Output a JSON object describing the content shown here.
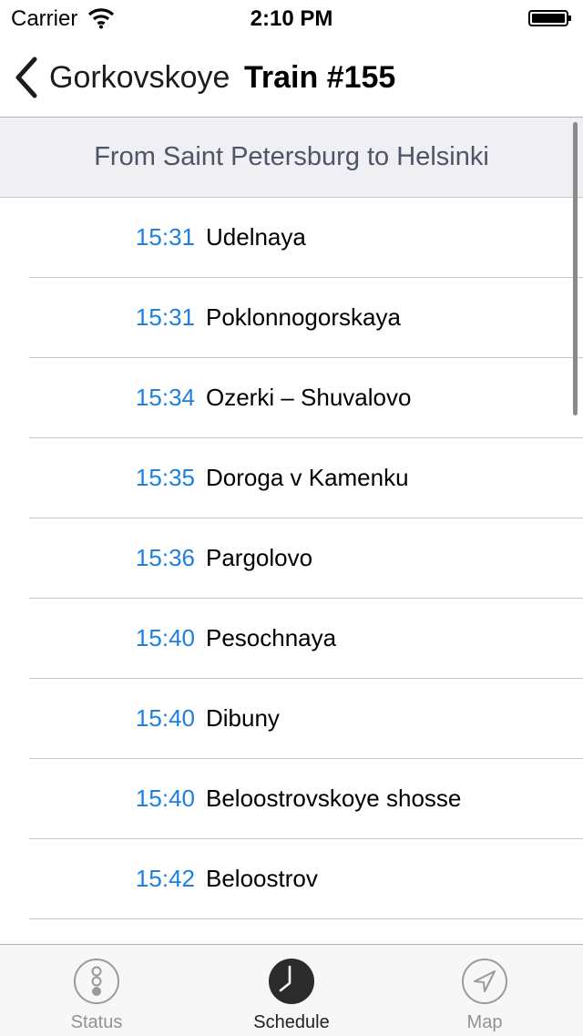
{
  "status_bar": {
    "carrier": "Carrier",
    "time": "2:10 PM"
  },
  "nav": {
    "back_label": "Gorkovskoye",
    "title": "Train #155"
  },
  "route_header": "From Saint Petersburg to Helsinki",
  "stops": [
    {
      "time": "15:31",
      "station": "Udelnaya"
    },
    {
      "time": "15:31",
      "station": "Poklonnogorskaya"
    },
    {
      "time": "15:34",
      "station": "Ozerki – Shuvalovo"
    },
    {
      "time": "15:35",
      "station": "Doroga v Kamenku"
    },
    {
      "time": "15:36",
      "station": "Pargolovo"
    },
    {
      "time": "15:40",
      "station": "Pesochnaya"
    },
    {
      "time": "15:40",
      "station": "Dibuny"
    },
    {
      "time": "15:40",
      "station": "Beloostrovskoye shosse"
    },
    {
      "time": "15:42",
      "station": "Beloostrov"
    }
  ],
  "tabs": [
    {
      "label": "Status",
      "icon": "traffic-light-icon",
      "active": false
    },
    {
      "label": "Schedule",
      "icon": "clock-icon",
      "active": true
    },
    {
      "label": "Map",
      "icon": "location-arrow-icon",
      "active": false
    }
  ],
  "colors": {
    "accent_time": "#1e7fe0",
    "header_bg": "#efeff4"
  }
}
